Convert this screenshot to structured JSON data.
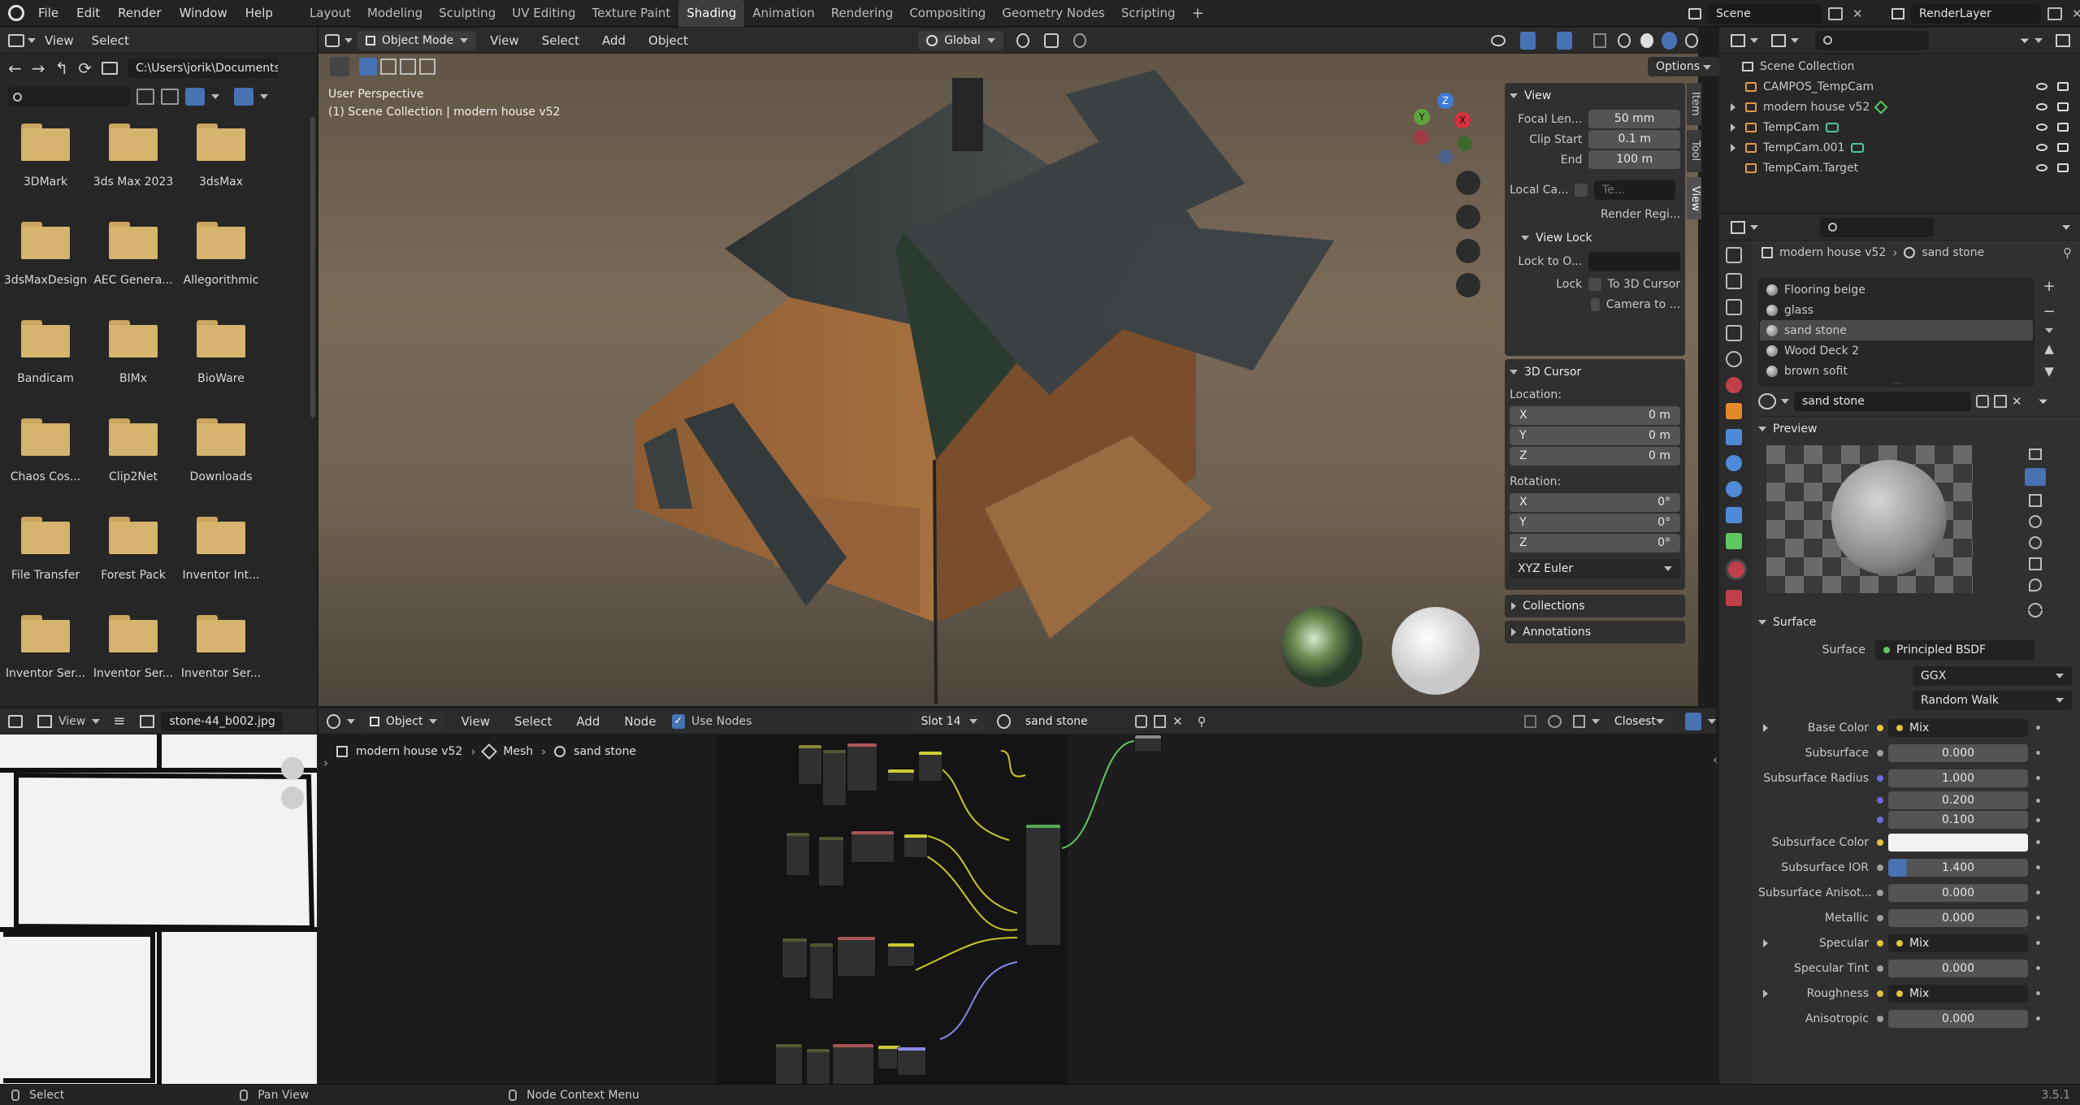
{
  "topbar": {
    "menus": [
      "File",
      "Edit",
      "Render",
      "Window",
      "Help"
    ],
    "workspaces": [
      "Layout",
      "Modeling",
      "Sculpting",
      "UV Editing",
      "Texture Paint",
      "Shading",
      "Animation",
      "Rendering",
      "Compositing",
      "Geometry Nodes",
      "Scripting"
    ],
    "active_workspace": "Shading",
    "scene": "Scene",
    "render_layer": "RenderLayer"
  },
  "file_browser": {
    "menus": [
      "View",
      "Select"
    ],
    "path": "C:\\Users\\jorik\\Documents\\",
    "folders": [
      "3DMark",
      "3ds Max 2023",
      "3dsMax",
      "3dsMaxDesign",
      "AEC Genera...",
      "Allegorithmic",
      "Bandicam",
      "BIMx",
      "BioWare",
      "Chaos Cos...",
      "Clip2Net",
      "Downloads",
      "File Transfer",
      "Forest Pack",
      "Inventor Int...",
      "Inventor Ser...",
      "Inventor Ser...",
      "Inventor Ser..."
    ]
  },
  "viewport": {
    "mode": "Object Mode",
    "menus": [
      "View",
      "Select",
      "Add",
      "Object"
    ],
    "transform": "Global",
    "options": "Options",
    "overlay_line1": "User Perspective",
    "overlay_line2": "(1) Scene Collection | modern house v52",
    "side_tabs": [
      "Item",
      "Tool",
      "View"
    ],
    "view_panel": {
      "title": "View",
      "focal_label": "Focal Len...",
      "focal": "50 mm",
      "clip_start_label": "Clip Start",
      "clip_start": "0.1 m",
      "end_label": "End",
      "end": "100 m",
      "local_cam_label": "Local Ca...",
      "local_cam": "Te...",
      "render_region": "Render Regi...",
      "view_lock": "View Lock",
      "lock_obj_label": "Lock to O...",
      "lock_label": "Lock",
      "to_cursor": "To 3D Cursor",
      "camera_to": "Camera to ..."
    },
    "cursor_panel": {
      "title": "3D Cursor",
      "location": "Location:",
      "lx": "0 m",
      "ly": "0 m",
      "lz": "0 m",
      "rotation": "Rotation:",
      "rx": "0°",
      "ry": "0°",
      "rz": "0°",
      "mode": "XYZ Euler"
    },
    "collections": "Collections",
    "annotations": "Annotations",
    "axes": {
      "x": "X",
      "y": "Y",
      "z": "Z"
    }
  },
  "image_editor": {
    "view": "View",
    "image": "stone-44_b002.jpg"
  },
  "node_editor": {
    "object": "Object",
    "menus": [
      "View",
      "Select",
      "Add",
      "Node"
    ],
    "use_nodes": "Use Nodes",
    "slot": "Slot 14",
    "material": "sand stone",
    "snap": "Closest",
    "breadcrumb": [
      "modern house v52",
      "Mesh",
      "sand stone"
    ]
  },
  "outliner": {
    "root": "Scene Collection",
    "items": [
      "CAMPOS_TempCam",
      "modern house v52",
      "TempCam",
      "TempCam.001",
      "TempCam.Target"
    ]
  },
  "properties": {
    "breadcrumb_obj": "modern house v52",
    "breadcrumb_mat": "sand stone",
    "materials": [
      "Flooring beige",
      "glass",
      "sand stone",
      "Wood Deck 2",
      "brown sofit"
    ],
    "active_material": "sand stone",
    "preview": "Preview",
    "surface_section": "Surface",
    "surface_label": "Surface",
    "surface_value": "Principled BSDF",
    "distribution": "GGX",
    "sss_method": "Random Walk",
    "params": [
      {
        "label": "Base Color",
        "value": "Mix",
        "kind": "link"
      },
      {
        "label": "Subsurface",
        "value": "0.000",
        "kind": "num"
      },
      {
        "label": "Subsurface Radius",
        "value": "1.000",
        "kind": "num"
      },
      {
        "label": "",
        "value": "0.200",
        "kind": "num"
      },
      {
        "label": "",
        "value": "0.100",
        "kind": "num"
      },
      {
        "label": "Subsurface Color",
        "value": "",
        "kind": "color"
      },
      {
        "label": "Subsurface IOR",
        "value": "1.400",
        "kind": "num"
      },
      {
        "label": "Subsurface Anisot...",
        "value": "0.000",
        "kind": "num"
      },
      {
        "label": "Metallic",
        "value": "0.000",
        "kind": "num"
      },
      {
        "label": "Specular",
        "value": "Mix",
        "kind": "link"
      },
      {
        "label": "Specular Tint",
        "value": "0.000",
        "kind": "num"
      },
      {
        "label": "Roughness",
        "value": "Mix",
        "kind": "link"
      },
      {
        "label": "Anisotropic",
        "value": "0.000",
        "kind": "num"
      }
    ]
  },
  "statusbar": {
    "select": "Select",
    "pan": "Pan View",
    "context": "Node Context Menu",
    "version": "3.5.1"
  }
}
